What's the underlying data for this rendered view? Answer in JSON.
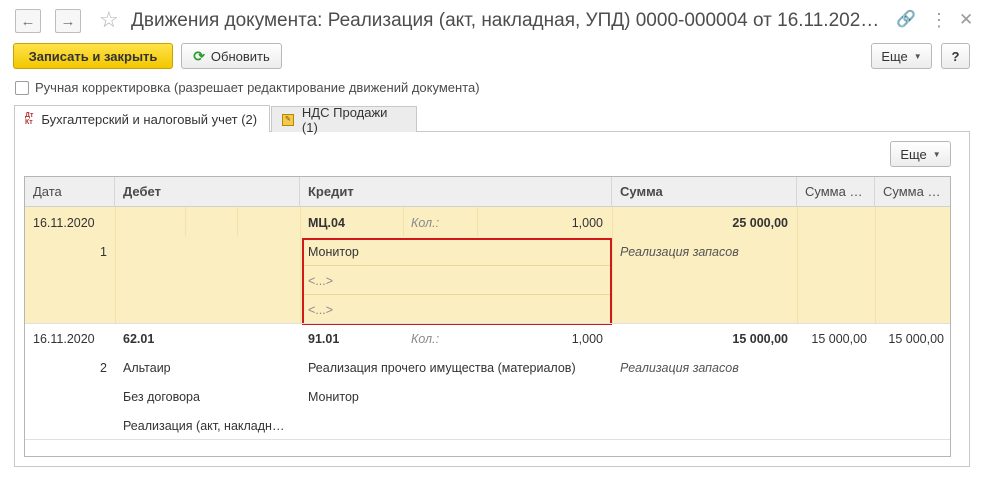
{
  "window": {
    "title": "Движения документа: Реализация (акт, накладная, УПД) 0000-000004 от 16.11.202…",
    "back_icon": "arrow-left-icon",
    "forward_icon": "arrow-right-icon",
    "favorite_icon": "star-icon",
    "link_icon": "link-icon",
    "more_icon": "vertical-dots-icon",
    "close_icon": "close-icon"
  },
  "toolbar": {
    "save_close_label": "Записать и закрыть",
    "refresh_label": "Обновить",
    "more_label": "Еще",
    "help_label": "?"
  },
  "manual_edit": {
    "label": "Ручная корректировка (разрешает редактирование движений документа)",
    "checked": false
  },
  "tabs": [
    {
      "label": "Бухгалтерский и налоговый учет (2)",
      "icon_top": "Дт",
      "icon_bottom": "Кт",
      "active": true
    },
    {
      "label": "НДС Продажи (1)",
      "active": false
    }
  ],
  "panel": {
    "more_label": "Еще"
  },
  "table": {
    "columns": [
      "Дата",
      "Дебет",
      "Кредит",
      "Сумма",
      "Сумма …",
      "Сумма …"
    ],
    "rows": [
      {
        "date": "16.11.2020",
        "num": "1",
        "debit": "",
        "debit_sub": [
          "",
          ""
        ],
        "credit_account": "МЦ.04",
        "qty_label": "Кол.:",
        "qty": "1,000",
        "credit_sub": [
          "Монитор",
          "<...>",
          "<...>"
        ],
        "amount": "25 000,00",
        "content": "Реализация запасов",
        "amount2": "",
        "amount3": ""
      },
      {
        "date": "16.11.2020",
        "num": "2",
        "debit": "62.01",
        "debit_sub": [
          "Альтаир",
          "Без договора",
          "Реализация (акт, накладн…"
        ],
        "credit_account": "91.01",
        "qty_label": "Кол.:",
        "qty": "1,000",
        "credit_sub": [
          "Реализация прочего имущества (материалов)",
          "Монитор"
        ],
        "amount": "15 000,00",
        "content": "Реализация запасов",
        "amount2": "15 000,00",
        "amount3": "15 000,00"
      }
    ]
  },
  "colors": {
    "accent_button": "#f2c700",
    "selected_row": "#fbeec1",
    "highlight_border": "#d01818"
  }
}
